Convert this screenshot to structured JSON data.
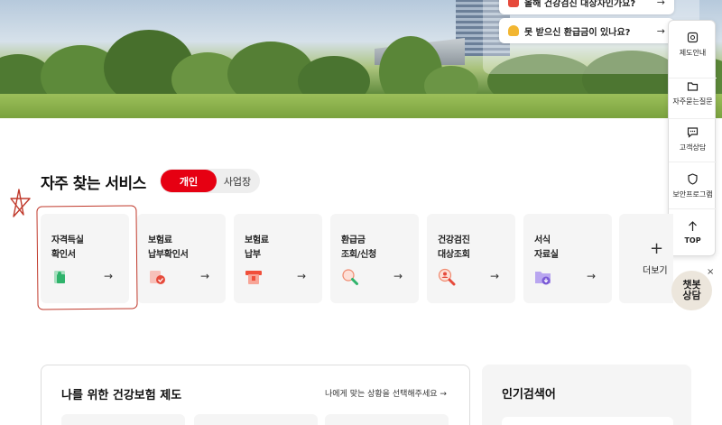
{
  "notices": [
    {
      "text": "올해 건강검진 대상자인가요?",
      "arrow": "→"
    },
    {
      "text": "못 받으신 환급금이 있나요?",
      "arrow": "→"
    }
  ],
  "quick_menu": [
    {
      "label": "제도안내",
      "icon": "info-doc-icon"
    },
    {
      "label": "자주묻는질문",
      "icon": "folder-question-icon"
    },
    {
      "label": "고객상담",
      "icon": "chat-bubble-icon"
    },
    {
      "label": "보안프로그램",
      "icon": "shield-icon"
    },
    {
      "label": "TOP",
      "icon": "arrow-up-icon"
    }
  ],
  "services": {
    "title": "자주 찾는 서비스",
    "tabs": [
      {
        "label": "개인",
        "active": true
      },
      {
        "label": "사업장",
        "active": false
      }
    ],
    "cards": [
      {
        "line1": "자격득실",
        "line2": "확인서",
        "icon": "certificate-icon",
        "color": "#2fb36b"
      },
      {
        "line1": "보험료",
        "line2": "납부확인서",
        "icon": "payment-check-icon",
        "color": "#e64a3b"
      },
      {
        "line1": "보험료",
        "line2": "납부",
        "icon": "payment-icon",
        "color": "#f04f3a"
      },
      {
        "line1": "환급금",
        "line2": "조회/신청",
        "icon": "search-refund-icon",
        "color": "#2fb36b"
      },
      {
        "line1": "건강검진",
        "line2": "대상조회",
        "icon": "person-search-icon",
        "color": "#e64a3b"
      },
      {
        "line1": "서식",
        "line2": "자료실",
        "icon": "folder-download-icon",
        "color": "#7b5bd6"
      }
    ],
    "arrow": "→",
    "more_label": "더보기",
    "more_symbol": "+"
  },
  "chatbot": {
    "line1": "챗봇",
    "line2": "상담",
    "close": "×"
  },
  "panel_left": {
    "title": "나를 위한 건강보험 제도",
    "link": "나에게 맞는 상황을 선택해주세요 →"
  },
  "panel_right": {
    "title": "인기검색어"
  },
  "colors": {
    "accent": "#e60012",
    "card_bg": "#f5f5f5",
    "annotation": "#c0392b"
  }
}
